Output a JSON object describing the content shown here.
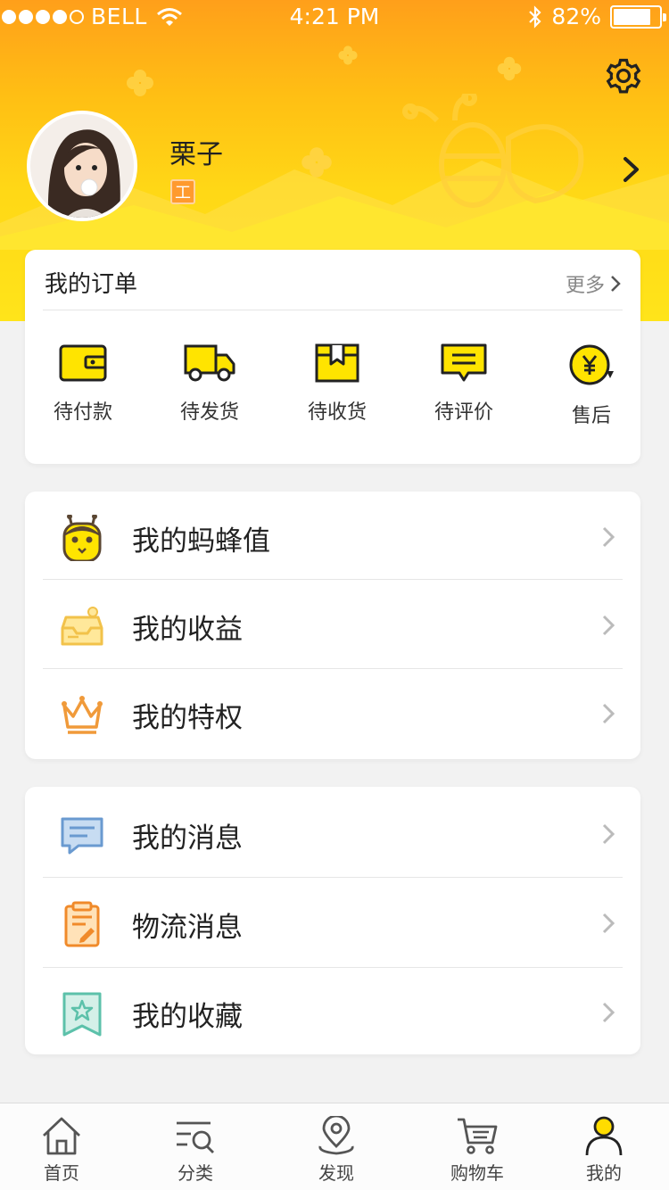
{
  "status_bar": {
    "carrier": "BELL",
    "time": "4:21 PM",
    "battery_pct": "82%",
    "battery_level": 0.82,
    "signal_bars": 4
  },
  "profile": {
    "name": "栗子",
    "badge": "工"
  },
  "orders": {
    "title": "我的订单",
    "more": "更多",
    "items": [
      {
        "label": "待付款",
        "icon": "wallet-icon"
      },
      {
        "label": "待发货",
        "icon": "truck-icon"
      },
      {
        "label": "待收货",
        "icon": "package-icon"
      },
      {
        "label": "待评价",
        "icon": "comment-icon"
      },
      {
        "label": "售后",
        "icon": "yuan-refund-icon"
      }
    ]
  },
  "menu_group_1": [
    {
      "label": "我的蚂蜂值",
      "icon": "bee-icon"
    },
    {
      "label": "我的收益",
      "icon": "inbox-icon"
    },
    {
      "label": "我的特权",
      "icon": "crown-icon"
    }
  ],
  "menu_group_2": [
    {
      "label": "我的消息",
      "icon": "message-icon"
    },
    {
      "label": "物流消息",
      "icon": "clipboard-icon"
    },
    {
      "label": "我的收藏",
      "icon": "bookmark-star-icon"
    }
  ],
  "tabbar": {
    "items": [
      {
        "label": "首页",
        "icon": "home-icon"
      },
      {
        "label": "分类",
        "icon": "category-search-icon"
      },
      {
        "label": "发现",
        "icon": "location-pin-icon"
      },
      {
        "label": "购物车",
        "icon": "cart-icon"
      },
      {
        "label": "我的",
        "icon": "user-icon"
      }
    ],
    "active": "我的"
  },
  "colors": {
    "brand_yellow": "#ffde1a",
    "brand_orange": "#ff9f1a",
    "active_tab": "#ffd700"
  }
}
